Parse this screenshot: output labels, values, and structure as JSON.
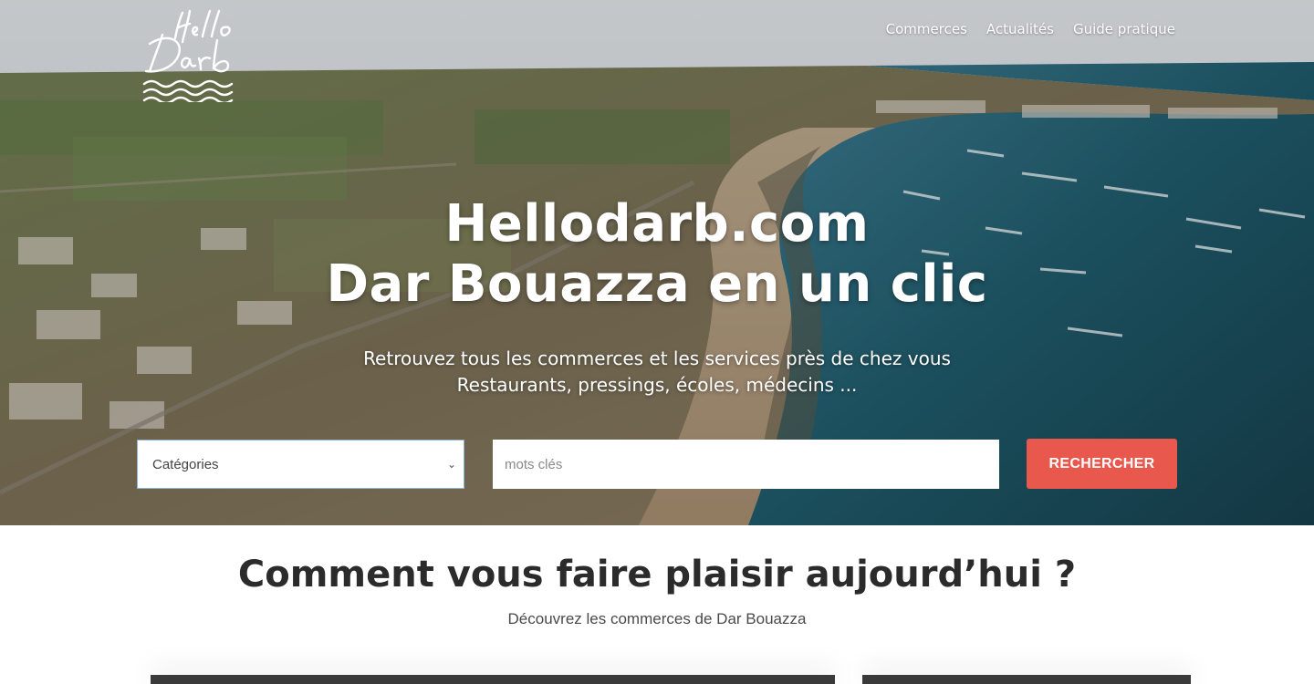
{
  "brand": {
    "logo_text": "Hello Darb"
  },
  "nav": {
    "items": [
      "Commerces",
      "Actualités",
      "Guide pratique"
    ]
  },
  "hero": {
    "title_line1": "Hellodarb.com",
    "title_line2": "Dar Bouazza en un clic",
    "subtitle_line1": "Retrouvez tous les commerces et les services près de chez vous",
    "subtitle_line2": "Restaurants, pressings, écoles, médecins ..."
  },
  "search": {
    "category_selected": "Catégories",
    "keywords_placeholder": "mots clés",
    "button_label": "RECHERCHER"
  },
  "section": {
    "title": "Comment vous faire plaisir aujourd’hui ?",
    "subtitle": "Découvrez les commerces de Dar Bouazza"
  },
  "colors": {
    "accent": "#e8584c",
    "heading": "#2b2b2b",
    "sea": "#1f5a6a"
  }
}
